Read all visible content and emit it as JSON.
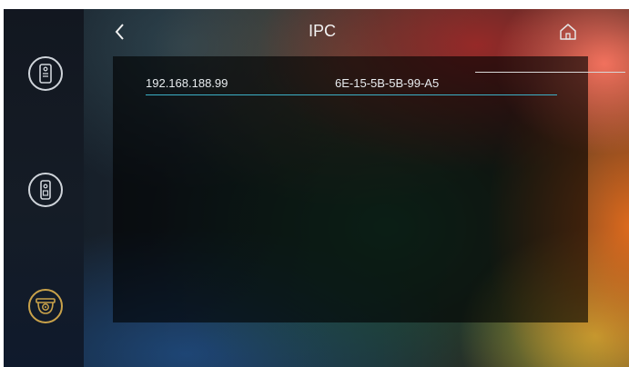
{
  "header": {
    "title": "IPC",
    "back_icon": "chevron-left-icon",
    "home_icon": "home-icon"
  },
  "sidebar": {
    "items": [
      {
        "icon": "outdoor-station-icon",
        "active": false
      },
      {
        "icon": "door-phone-icon",
        "active": false
      },
      {
        "icon": "ip-camera-icon",
        "active": true
      }
    ]
  },
  "devices": [
    {
      "ip": "192.168.188.99",
      "mac": "6E-15-5B-5B-99-A5"
    }
  ],
  "colors": {
    "accent": "#c9a24a",
    "row_divider": "#3cb0c7",
    "text": "#e8ecef"
  }
}
